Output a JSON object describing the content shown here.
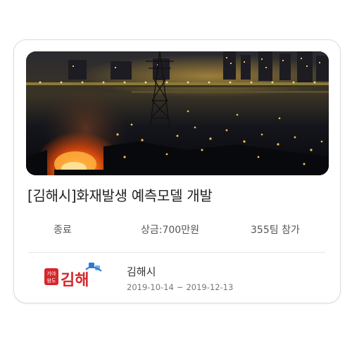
{
  "card": {
    "image_alt": "nighttime fire at industrial area with transmission tower",
    "title": "[김해시]화재발생 예측모델 개발",
    "status": "종료",
    "prize": "상금:700만원",
    "teams": "355팀 참가",
    "organizer": "김해시",
    "start_date": "2019-10-14",
    "date_separator": "~",
    "end_date": "2019-12-13",
    "logo": {
      "badge_text": "가야\n왕도",
      "text": "김해",
      "icon": "gimhae-city-logo"
    }
  },
  "colors": {
    "title": "#222222",
    "meta": "#555555",
    "date": "#777777",
    "logo_red": "#d7262b",
    "logo_blue": "#2d7ad6"
  }
}
